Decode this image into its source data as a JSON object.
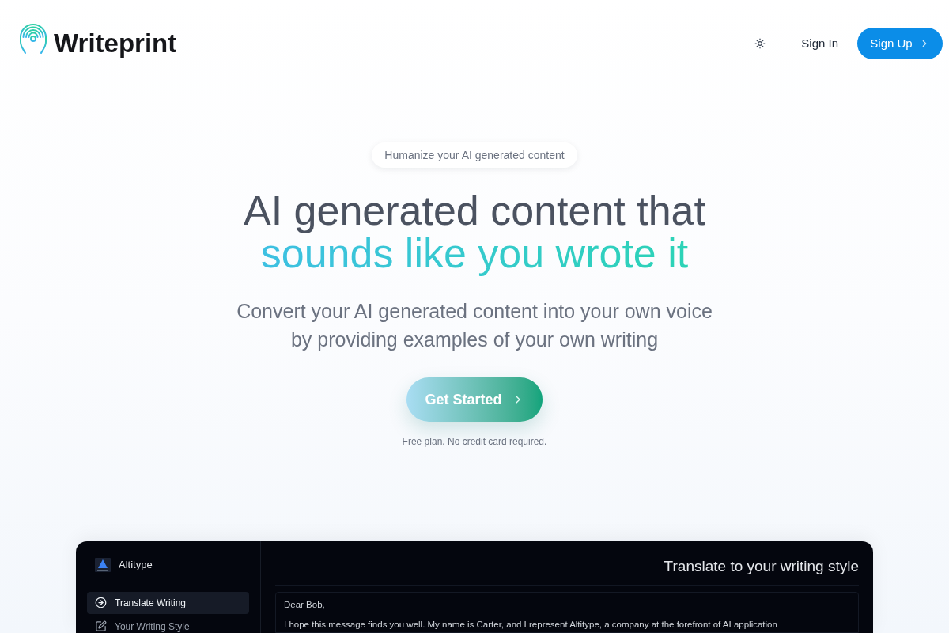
{
  "header": {
    "brand": "Writeprint",
    "sign_in": "Sign In",
    "sign_up": "Sign Up"
  },
  "hero": {
    "badge": "Humanize your AI generated content",
    "title_line_1": "AI generated content that",
    "title_line_2": "sounds like you wrote it",
    "subtitle": "Convert your AI generated content into your own voice by providing examples of your own writing",
    "cta": "Get Started",
    "note": "Free plan. No credit card required."
  },
  "app_preview": {
    "workspace": "Altitype",
    "sidebar": {
      "items": [
        {
          "label": "Translate Writing",
          "selected": true
        },
        {
          "label": "Your Writing Style",
          "selected": false
        }
      ]
    },
    "title": "Translate to your writing style",
    "editor": {
      "value": [
        "Dear Bob,",
        "I hope this message finds you well. My name is Carter, and I represent Altitype, a company at the forefront of AI application"
      ]
    }
  }
}
